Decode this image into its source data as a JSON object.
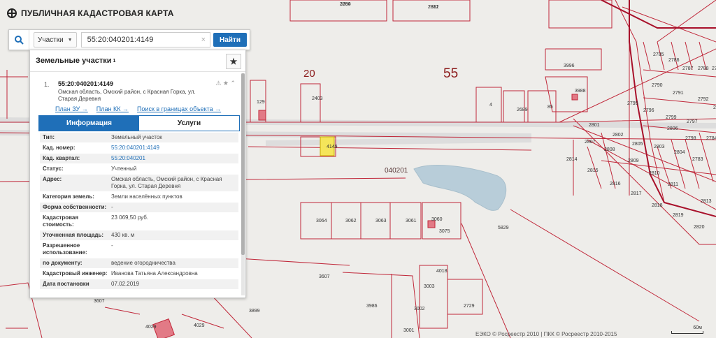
{
  "app": {
    "title": "ПУБЛИЧНАЯ КАДАСТРОВАЯ КАРТА"
  },
  "search": {
    "type_selected": "Участки",
    "query": "55:20:040201:4149",
    "clear_label": "×",
    "submit_label": "Найти"
  },
  "panel": {
    "title": "Земельные участки",
    "count": "1",
    "result": {
      "index": "1.",
      "cad_number": "55:20:040201:4149",
      "address": "Омская область, Омский район, с Красная Горка, ул. Старая Деревня"
    },
    "links": [
      "План ЗУ →",
      "План КК →",
      "Поиск в границах объекта →"
    ],
    "tabs": [
      "Информация",
      "Услуги"
    ],
    "properties": [
      {
        "k": "Тип:",
        "v": "Земельный участок"
      },
      {
        "k": "Кад. номер:",
        "v": "55:20:040201:4149"
      },
      {
        "k": "Кад. квартал:",
        "v": "55:20:040201"
      },
      {
        "k": "Статус:",
        "v": "Учтенный"
      },
      {
        "k": "Адрес:",
        "v": "Омская область, Омский район, с Красная Горка, ул. Старая Деревня"
      },
      {
        "k": "Категория земель:",
        "v": "Земли населённых пунктов"
      },
      {
        "k": "Форма собственности:",
        "v": "-"
      },
      {
        "k": "Кадастровая стоимость:",
        "v": "23 069,50 руб."
      },
      {
        "k": "Уточненная площадь:",
        "v": "430 кв. м"
      },
      {
        "k": "Разрешенное использование:",
        "v": "-"
      },
      {
        "k": "по документу:",
        "v": "ведение огородничества"
      },
      {
        "k": "Кадастровый инженер:",
        "v": "Иванова Татьяна Александровна"
      },
      {
        "k": "Дата постановки",
        "v": "07.02.2019"
      }
    ]
  },
  "map": {
    "zone_label": "55",
    "district_label": "20",
    "quarter_label": "040201",
    "parcel_labels": [
      "3980",
      "2881",
      "3996",
      "3988",
      "4",
      "2689",
      "85",
      "129",
      "2403",
      "4149",
      "3064",
      "3062",
      "3063",
      "3061",
      "3060",
      "3075",
      "5829",
      "4018",
      "3607",
      "3003",
      "3986",
      "3002",
      "2729",
      "3001",
      "3899",
      "3607",
      "4029",
      "4029",
      "2801",
      "2802",
      "2807",
      "2808",
      "2814",
      "2815",
      "2816",
      "2817",
      "2818",
      "2819",
      "2820",
      "2813",
      "2811",
      "2810",
      "2809",
      "2804",
      "2803",
      "2805",
      "2806",
      "2797",
      "2796",
      "2795",
      "2791",
      "2790",
      "2792",
      "2793",
      "2789",
      "2788",
      "2787",
      "2786",
      "2785",
      "2784",
      "2783",
      "2799",
      "2798",
      "2794",
      "2812"
    ],
    "attribution": "ЕЭКО © Росреестр 2010 | ПКК © Росреестр 2010-2015",
    "scale_label": "60м"
  },
  "colors": {
    "accent": "#1f6fb8",
    "boundary": "#c0283a",
    "water": "#b8cdd9",
    "highlight": "#f5e55a"
  }
}
